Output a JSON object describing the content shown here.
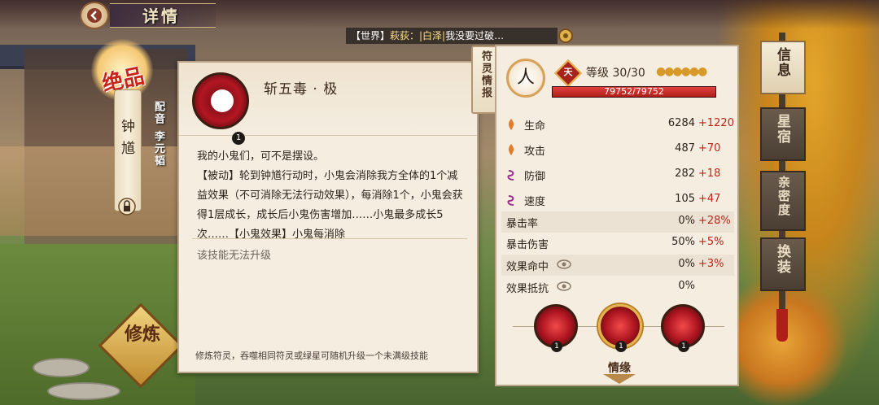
{
  "header": {
    "title": "详情",
    "back_icon": "back-arrow-icon"
  },
  "chat": {
    "channel": "【世界】",
    "sender": "萩荻：|白泽|",
    "message": "我没要过破…",
    "settings_icon": "gear-icon"
  },
  "character": {
    "rank": "绝品",
    "name": "钟馗",
    "voice": "配音 李元韬",
    "cultivate_label": "修炼"
  },
  "skill": {
    "name": "斩五毒 · 极",
    "level": "1",
    "description": "我的小鬼们，可不是摆设。\n【被动】轮到钟馗行动时，小鬼会消除我方全体的1个减益效果（不可消除无法行动效果），每消除1个，小鬼会获得1层成长，成长后小鬼伤害增加……小鬼最多成长5次……【小鬼效果】小鬼每消除",
    "note": "该技能无法升级",
    "footer": "修炼符灵，吞噬相同符灵或绿星可随机升级一个未满级技能"
  },
  "info_tab": {
    "label": "符灵情报"
  },
  "stats": {
    "class_label": "人",
    "grade_label": "天",
    "level_text": "等级 30/30",
    "stars": "●●●●●●",
    "hp_text": "79752/79752",
    "hp_fraction": 1.0,
    "rows": [
      {
        "label": "生命",
        "value": "6284",
        "bonus": "+1220",
        "icon": "flame-icon"
      },
      {
        "label": "攻击",
        "value": "487",
        "bonus": "+70",
        "icon": "flame-icon"
      },
      {
        "label": "防御",
        "value": "282",
        "bonus": "+18",
        "icon": "spiral-icon"
      },
      {
        "label": "速度",
        "value": "105",
        "bonus": "+47",
        "icon": "spiral-icon"
      },
      {
        "label": "暴击率",
        "value": "0%",
        "bonus": "+28%"
      },
      {
        "label": "暴击伤害",
        "value": "50%",
        "bonus": "+5%"
      },
      {
        "label": "效果命中",
        "value": "0%",
        "bonus": "+3%",
        "icon": "eye-icon"
      },
      {
        "label": "效果抵抗",
        "value": "0%",
        "bonus": "",
        "icon": "eye-icon"
      }
    ],
    "skill_levels": [
      "1",
      "1",
      "1"
    ]
  },
  "fate_label": "情缘",
  "side_tabs": [
    {
      "label": "信息",
      "active": true
    },
    {
      "label": "星宿",
      "active": false
    },
    {
      "label": "亲密度",
      "active": false
    },
    {
      "label": "换装",
      "active": false
    }
  ],
  "colors": {
    "accent_red": "#c0241b",
    "panel": "#f4ede0",
    "border": "#b9a58a"
  }
}
